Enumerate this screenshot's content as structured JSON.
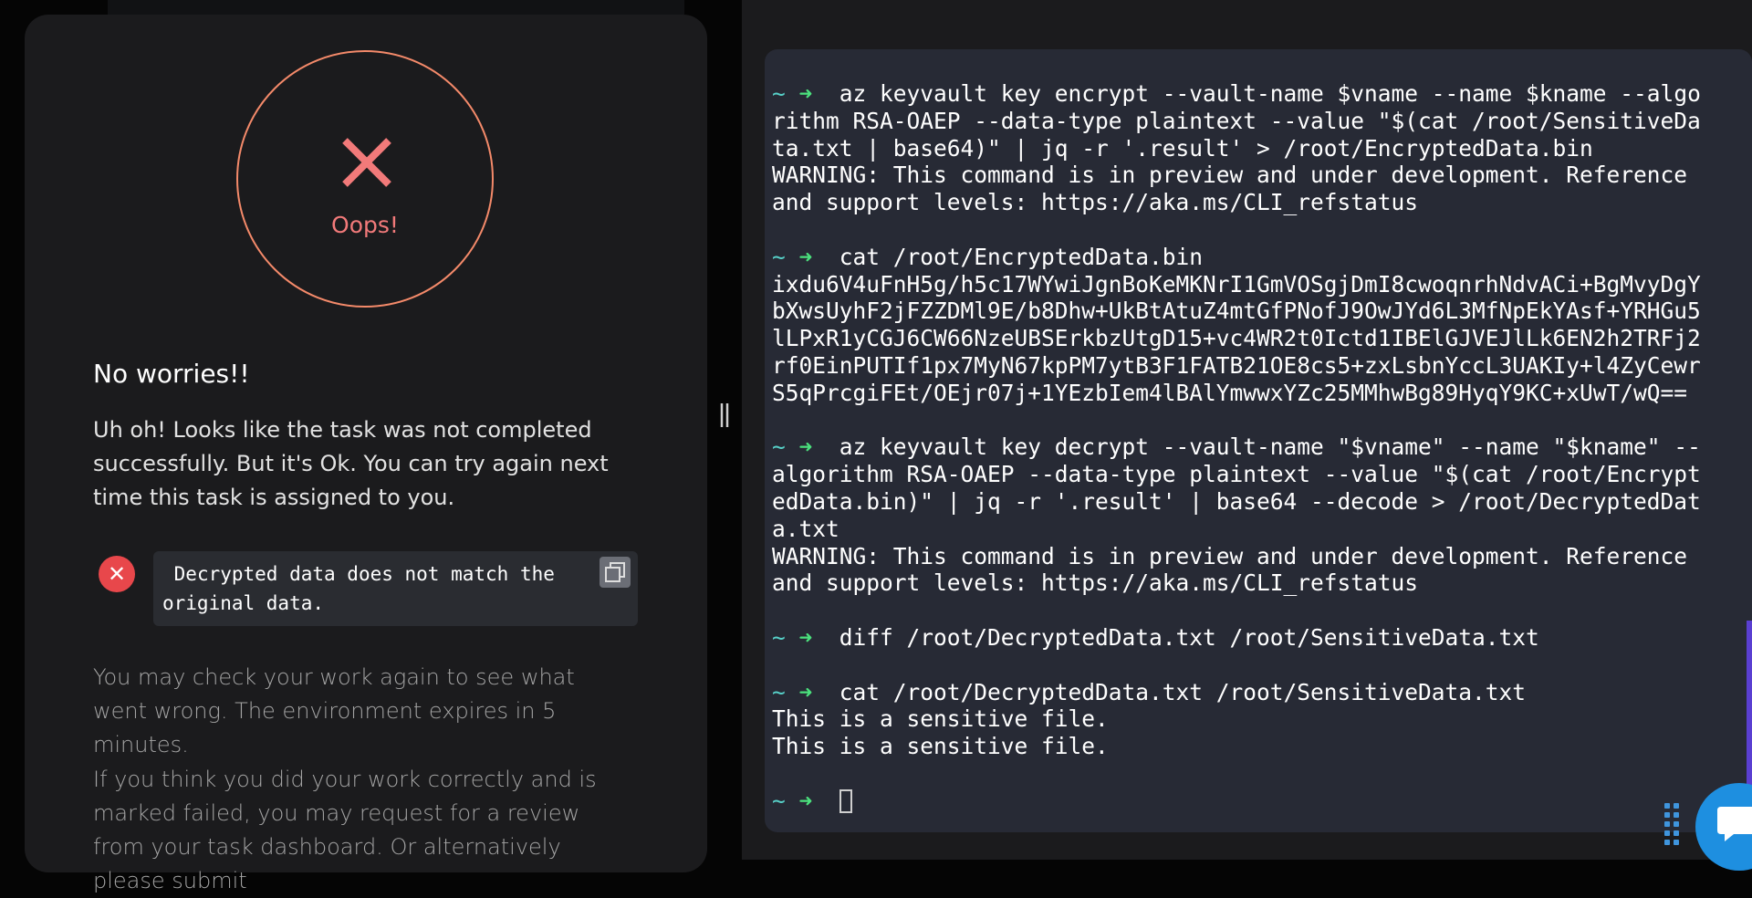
{
  "result": {
    "status_label": "Oops!",
    "heading": "No worries!!",
    "message": "Uh oh! Looks like the task was not completed successfully. But it's Ok. You can try again next time this task is assigned to you.",
    "error_text": " Decrypted data does not match the\noriginal data.",
    "check_message": "You may check your work again to see what went wrong. The environment expires in 5 minutes.",
    "review_message": "If you think you did your work correctly and is marked failed, you may request for a review from your task dashboard. Or alternatively please submit",
    "colors": {
      "accent": "#f27a7a",
      "error": "#e8474b"
    }
  },
  "terminal": {
    "prompt": "~",
    "arrow": "➜",
    "blocks": [
      {
        "command": "  az keyvault key encrypt --vault-name $vname --name $kname --algo",
        "continuation": [
          "rithm RSA-OAEP --data-type plaintext --value \"$(cat /root/SensitiveDa",
          "ta.txt | base64)\" | jq -r '.result' > /root/EncryptedData.bin"
        ],
        "output": [
          "WARNING: This command is in preview and under development. Reference",
          "and support levels: https://aka.ms/CLI_refstatus"
        ]
      },
      {
        "command": "  cat /root/EncryptedData.bin",
        "continuation": [],
        "output": [
          "ixdu6V4uFnH5g/h5c17WYwiJgnBoKeMKNrI1GmVOSgjDmI8cwoqnrhNdvACi+BgMvyDgY",
          "bXwsUyhF2jFZZDMl9E/b8Dhw+UkBtAtuZ4mtGfPNofJ9OwJYd6L3MfNpEkYAsf+YRHGu5",
          "lLPxR1yCGJ6CW66NzeUBSErkbzUtgD15+vc4WR2t0Ictd1IBElGJVEJlLk6EN2h2TRFj2",
          "rf0EinPUTIf1px7MyN67kpPM7ytB3F1FATB21OE8cs5+zxLsbnYccL3UAKIy+l4ZyCewr",
          "S5qPrcgiFEt/OEjr07j+1YEzbIem4lBAlYmwwxYZc25MMhwBg89HyqY9KC+xUwT/wQ=="
        ]
      },
      {
        "command": "  az keyvault key decrypt --vault-name \"$vname\" --name \"$kname\" --",
        "continuation": [
          "algorithm RSA-OAEP --data-type plaintext --value \"$(cat /root/Encrypt",
          "edData.bin)\" | jq -r '.result' | base64 --decode > /root/DecryptedDat",
          "a.txt"
        ],
        "output": [
          "WARNING: This command is in preview and under development. Reference",
          "and support levels: https://aka.ms/CLI_refstatus"
        ]
      },
      {
        "command": "  diff /root/DecryptedData.txt /root/SensitiveData.txt",
        "continuation": [],
        "output": []
      },
      {
        "command": "  cat /root/DecryptedData.txt /root/SensitiveData.txt",
        "continuation": [],
        "output": [
          "This is a sensitive file.",
          "This is a sensitive file."
        ]
      }
    ],
    "colors": {
      "prompt": "#57d1c9",
      "arrow": "#4be17d",
      "background": "#272a35"
    }
  },
  "icons": {
    "status": "close-icon",
    "error": "close-icon",
    "copy": "copy-icon",
    "divider": "drag-handle-icon",
    "grip": "grip-dots-icon",
    "chat": "chat-bubble-icon"
  }
}
